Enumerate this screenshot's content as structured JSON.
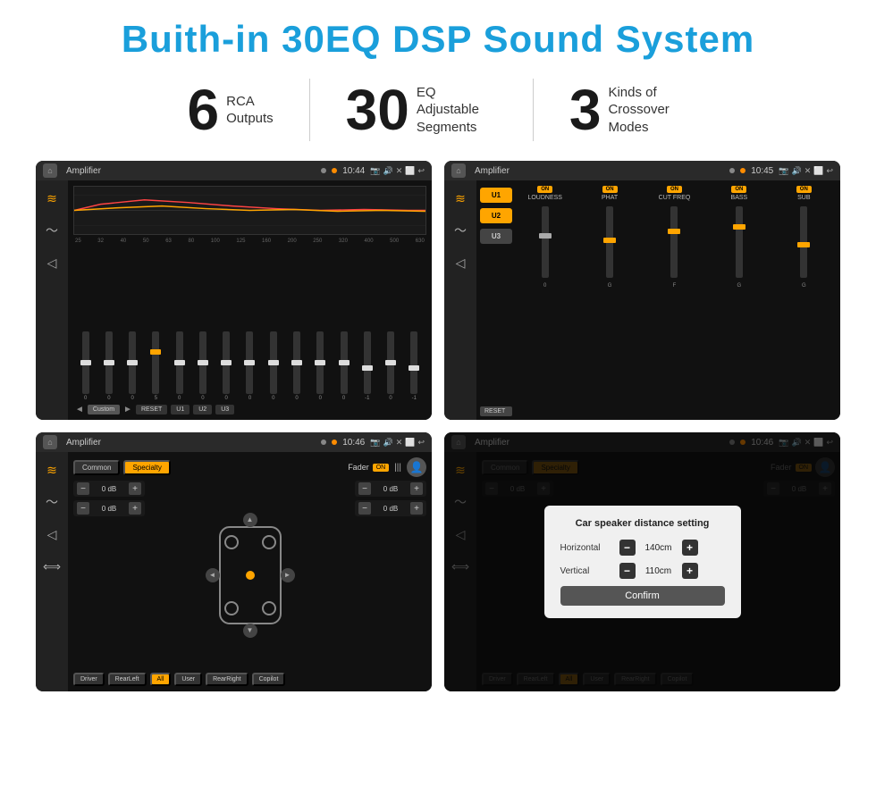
{
  "title": "Buith-in 30EQ DSP Sound System",
  "stats": [
    {
      "number": "6",
      "label": "RCA\nOutputs"
    },
    {
      "number": "30",
      "label": "EQ Adjustable\nSegments"
    },
    {
      "number": "3",
      "label": "Kinds of\nCrossover Modes"
    }
  ],
  "screens": [
    {
      "id": "eq-screen",
      "statusBar": {
        "title": "Amplifier",
        "time": "10:44"
      },
      "type": "eq",
      "eqBands": [
        "25",
        "32",
        "40",
        "50",
        "63",
        "80",
        "100",
        "125",
        "160",
        "200",
        "250",
        "320",
        "400",
        "500",
        "630"
      ],
      "eqValues": [
        "0",
        "0",
        "0",
        "5",
        "0",
        "0",
        "0",
        "0",
        "0",
        "0",
        "0",
        "0",
        "-1",
        "0",
        "-1"
      ],
      "thumbPositions": [
        50,
        50,
        50,
        35,
        50,
        50,
        50,
        50,
        50,
        50,
        50,
        50,
        60,
        50,
        60
      ],
      "bottomButtons": [
        "◄",
        "Custom",
        "►",
        "RESET",
        "U1",
        "U2",
        "U3"
      ]
    },
    {
      "id": "crossover-screen",
      "statusBar": {
        "title": "Amplifier",
        "time": "10:45"
      },
      "type": "crossover",
      "uButtons": [
        "U1",
        "U2",
        "U3"
      ],
      "columns": [
        {
          "label": "LOUDNESS",
          "on": true
        },
        {
          "label": "PHAT",
          "on": true
        },
        {
          "label": "CUT FREQ",
          "on": true
        },
        {
          "label": "BASS",
          "on": true
        },
        {
          "label": "SUB",
          "on": true
        }
      ]
    },
    {
      "id": "fader-screen",
      "statusBar": {
        "title": "Amplifier",
        "time": "10:46"
      },
      "type": "fader",
      "tabs": [
        "Common",
        "Specialty"
      ],
      "faderLabel": "Fader",
      "volumes": [
        "0 dB",
        "0 dB",
        "0 dB",
        "0 dB"
      ],
      "bottomButtons": [
        "Driver",
        "RearLeft",
        "All",
        "User",
        "RearRight",
        "Copilot"
      ]
    },
    {
      "id": "distance-screen",
      "statusBar": {
        "title": "Amplifier",
        "time": "10:46"
      },
      "type": "distance",
      "tabs": [
        "Common",
        "Specialty"
      ],
      "dialog": {
        "title": "Car speaker distance setting",
        "horizontal": {
          "label": "Horizontal",
          "value": "140cm"
        },
        "vertical": {
          "label": "Vertical",
          "value": "110cm"
        },
        "confirmLabel": "Confirm"
      },
      "volumes": [
        "0 dB",
        "0 dB"
      ],
      "bottomButtons": [
        "Driver",
        "RearLeft",
        "All",
        "User",
        "RearRight",
        "Copilot"
      ]
    }
  ],
  "icons": {
    "home": "⌂",
    "location": "📍",
    "speaker": "🔊",
    "close": "✕",
    "back": "↩",
    "settings": "⚙",
    "eq": "≋",
    "wave": "〜",
    "volume": "◁",
    "arrows": "⟺",
    "left": "◄",
    "right": "►",
    "up": "▲",
    "down": "▼"
  }
}
